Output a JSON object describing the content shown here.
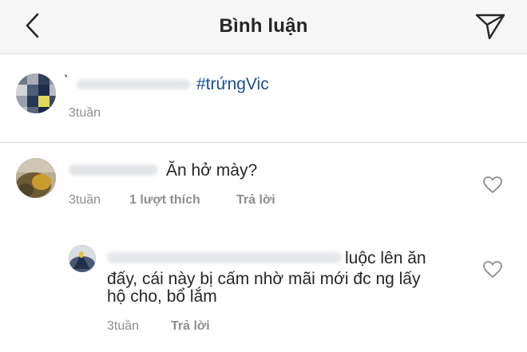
{
  "header": {
    "title": "Bình luận",
    "back_icon": "chevron-left-icon",
    "send_icon": "paper-plane-icon"
  },
  "caption": {
    "name_fragment": "̀",
    "hashtag": "#trứngVic",
    "time": "3tuần"
  },
  "comments": [
    {
      "text": "Ăn hở mày?",
      "time": "3tuần",
      "likes": "1 lượt thích",
      "reply": "Trả lời"
    },
    {
      "text_line1": "luộc lên ăn",
      "text_line2": "đấy, cái này bị cấm nhờ mãi mới đc ng lấy",
      "text_line3": "hộ cho, bổ lắm",
      "time": "3tuần",
      "reply": "Trả lời"
    }
  ],
  "colors": {
    "header_bg": "#f6f6f6",
    "hashtag": "#1b4f93",
    "meta_text": "#8e8e8e",
    "divider": "#dbdbdb"
  }
}
